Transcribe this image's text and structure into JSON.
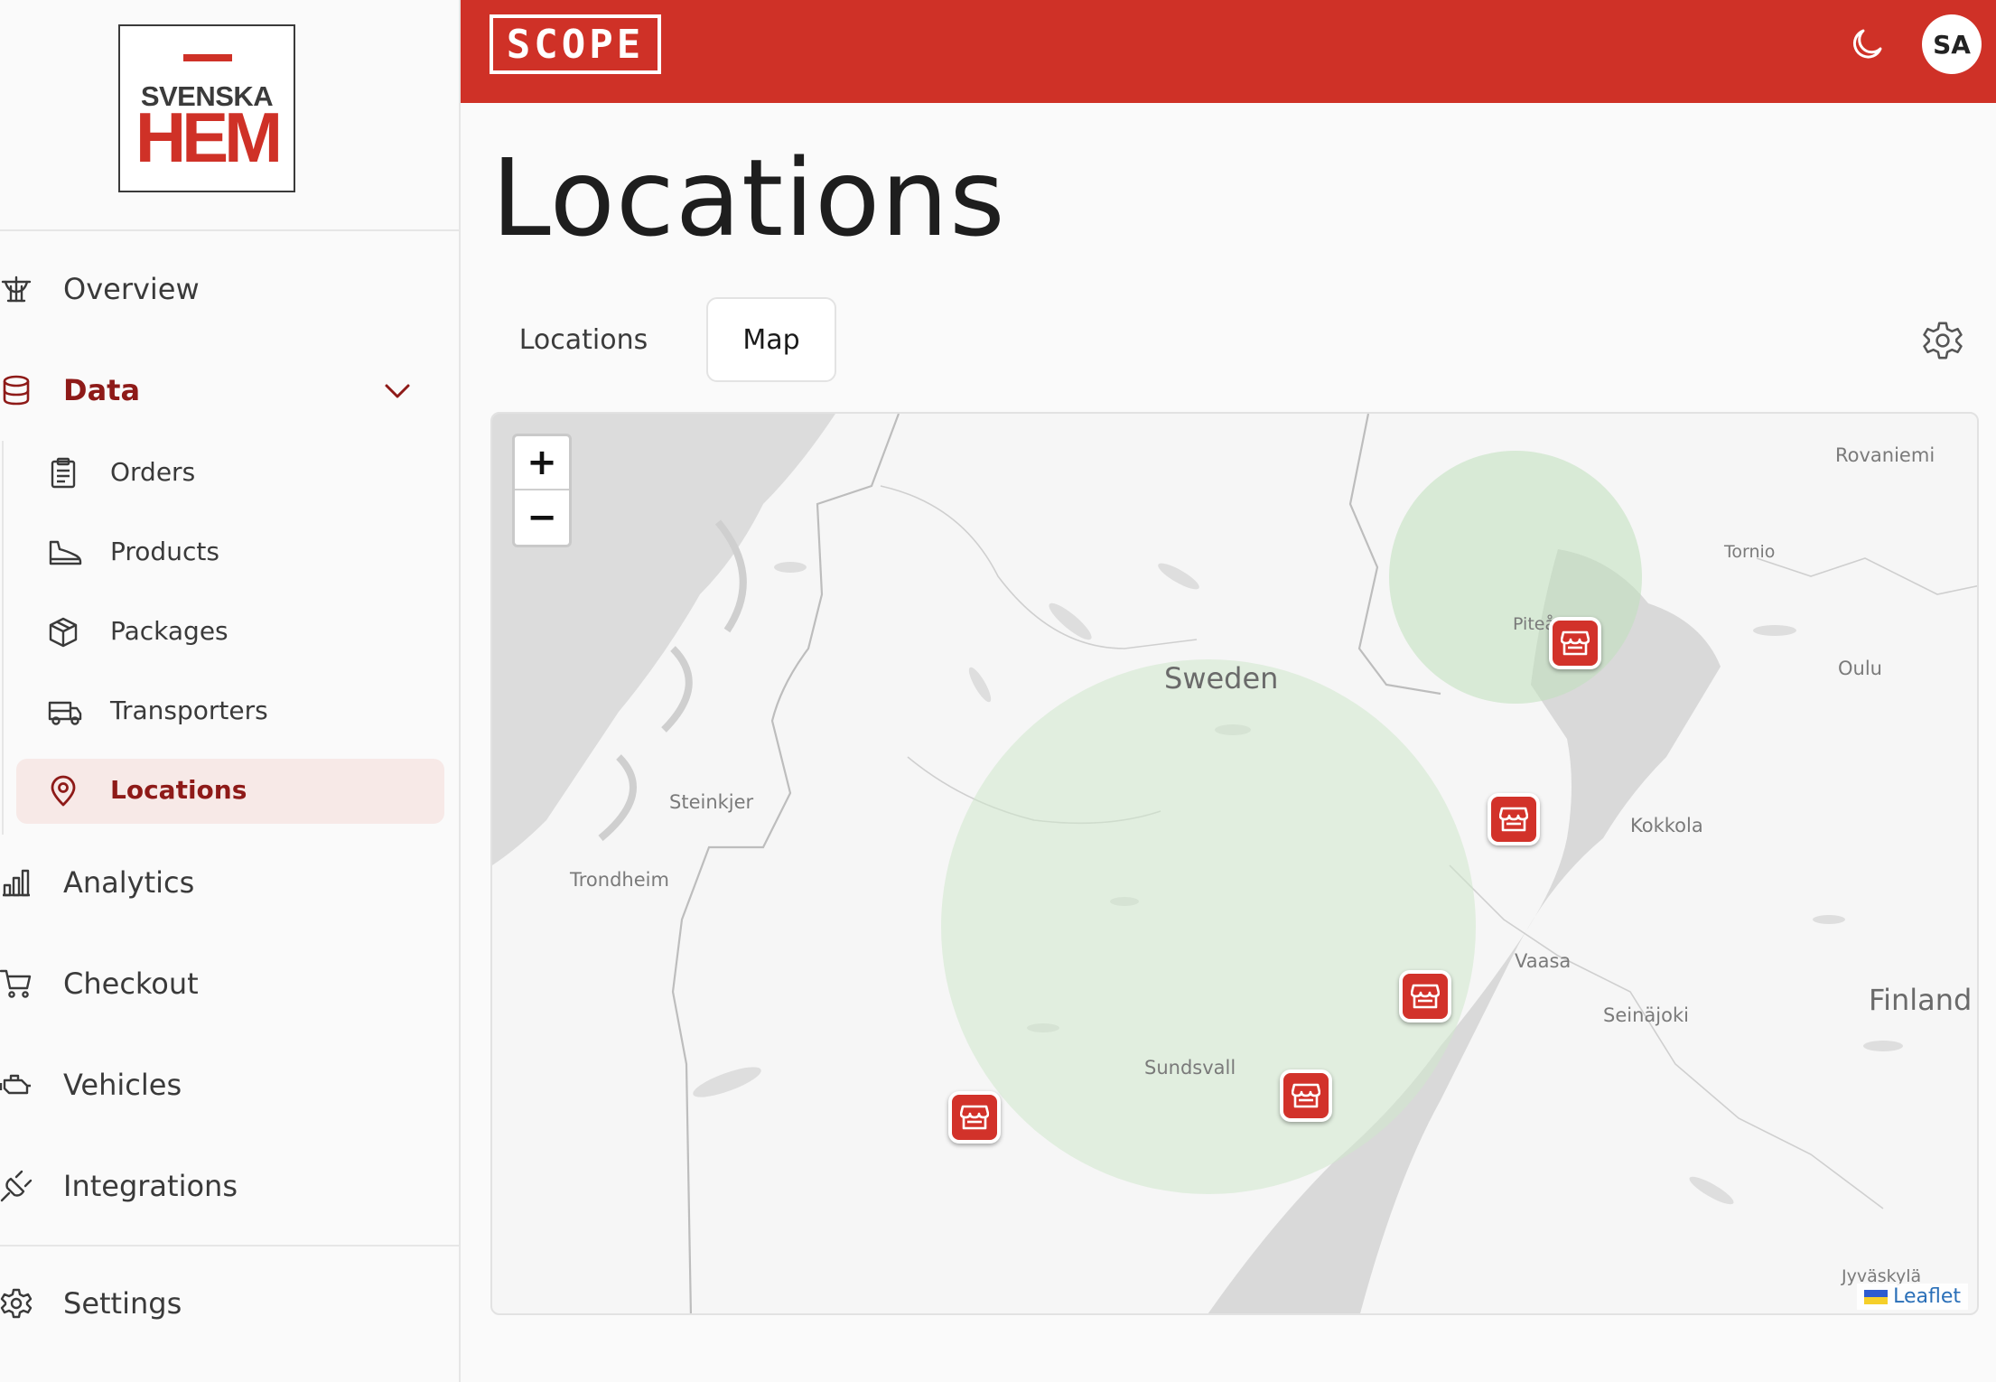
{
  "logo": {
    "top": "SVENSKA",
    "main": "HEM"
  },
  "brand": {
    "name": "SCOPE"
  },
  "user": {
    "initials": "SA"
  },
  "nav": {
    "overview": "Overview",
    "data": "Data",
    "sub": {
      "orders": "Orders",
      "products": "Products",
      "packages": "Packages",
      "transporters": "Transporters",
      "locations": "Locations"
    },
    "analytics": "Analytics",
    "checkout": "Checkout",
    "vehicles": "Vehicles",
    "integrations": "Integrations",
    "settings": "Settings"
  },
  "page": {
    "title": "Locations"
  },
  "tabs": {
    "list": "Locations",
    "map": "Map",
    "selected": "Map"
  },
  "map": {
    "zoom_in": "+",
    "zoom_out": "−",
    "attribution": "Leaflet",
    "labels": {
      "rovaniemi": "Rovaniemi",
      "tornio": "Tornio",
      "pitea": "Piteå",
      "oulu": "Oulu",
      "sweden": "Sweden",
      "steinkjer": "Steinkjer",
      "trondheim": "Trondheim",
      "kokkola": "Kokkola",
      "vaasa": "Vaasa",
      "seinajoki": "Seinäjoki",
      "finland": "Finland",
      "sundsvall": "Sundsvall",
      "jyvaskyla": "Jyväskylä"
    }
  },
  "colors": {
    "brand_red": "#cf3127",
    "active_text": "#8e1a18",
    "active_bg": "#f7e9e7",
    "marker": "#d2322a",
    "coverage": "#cfe8cc"
  }
}
